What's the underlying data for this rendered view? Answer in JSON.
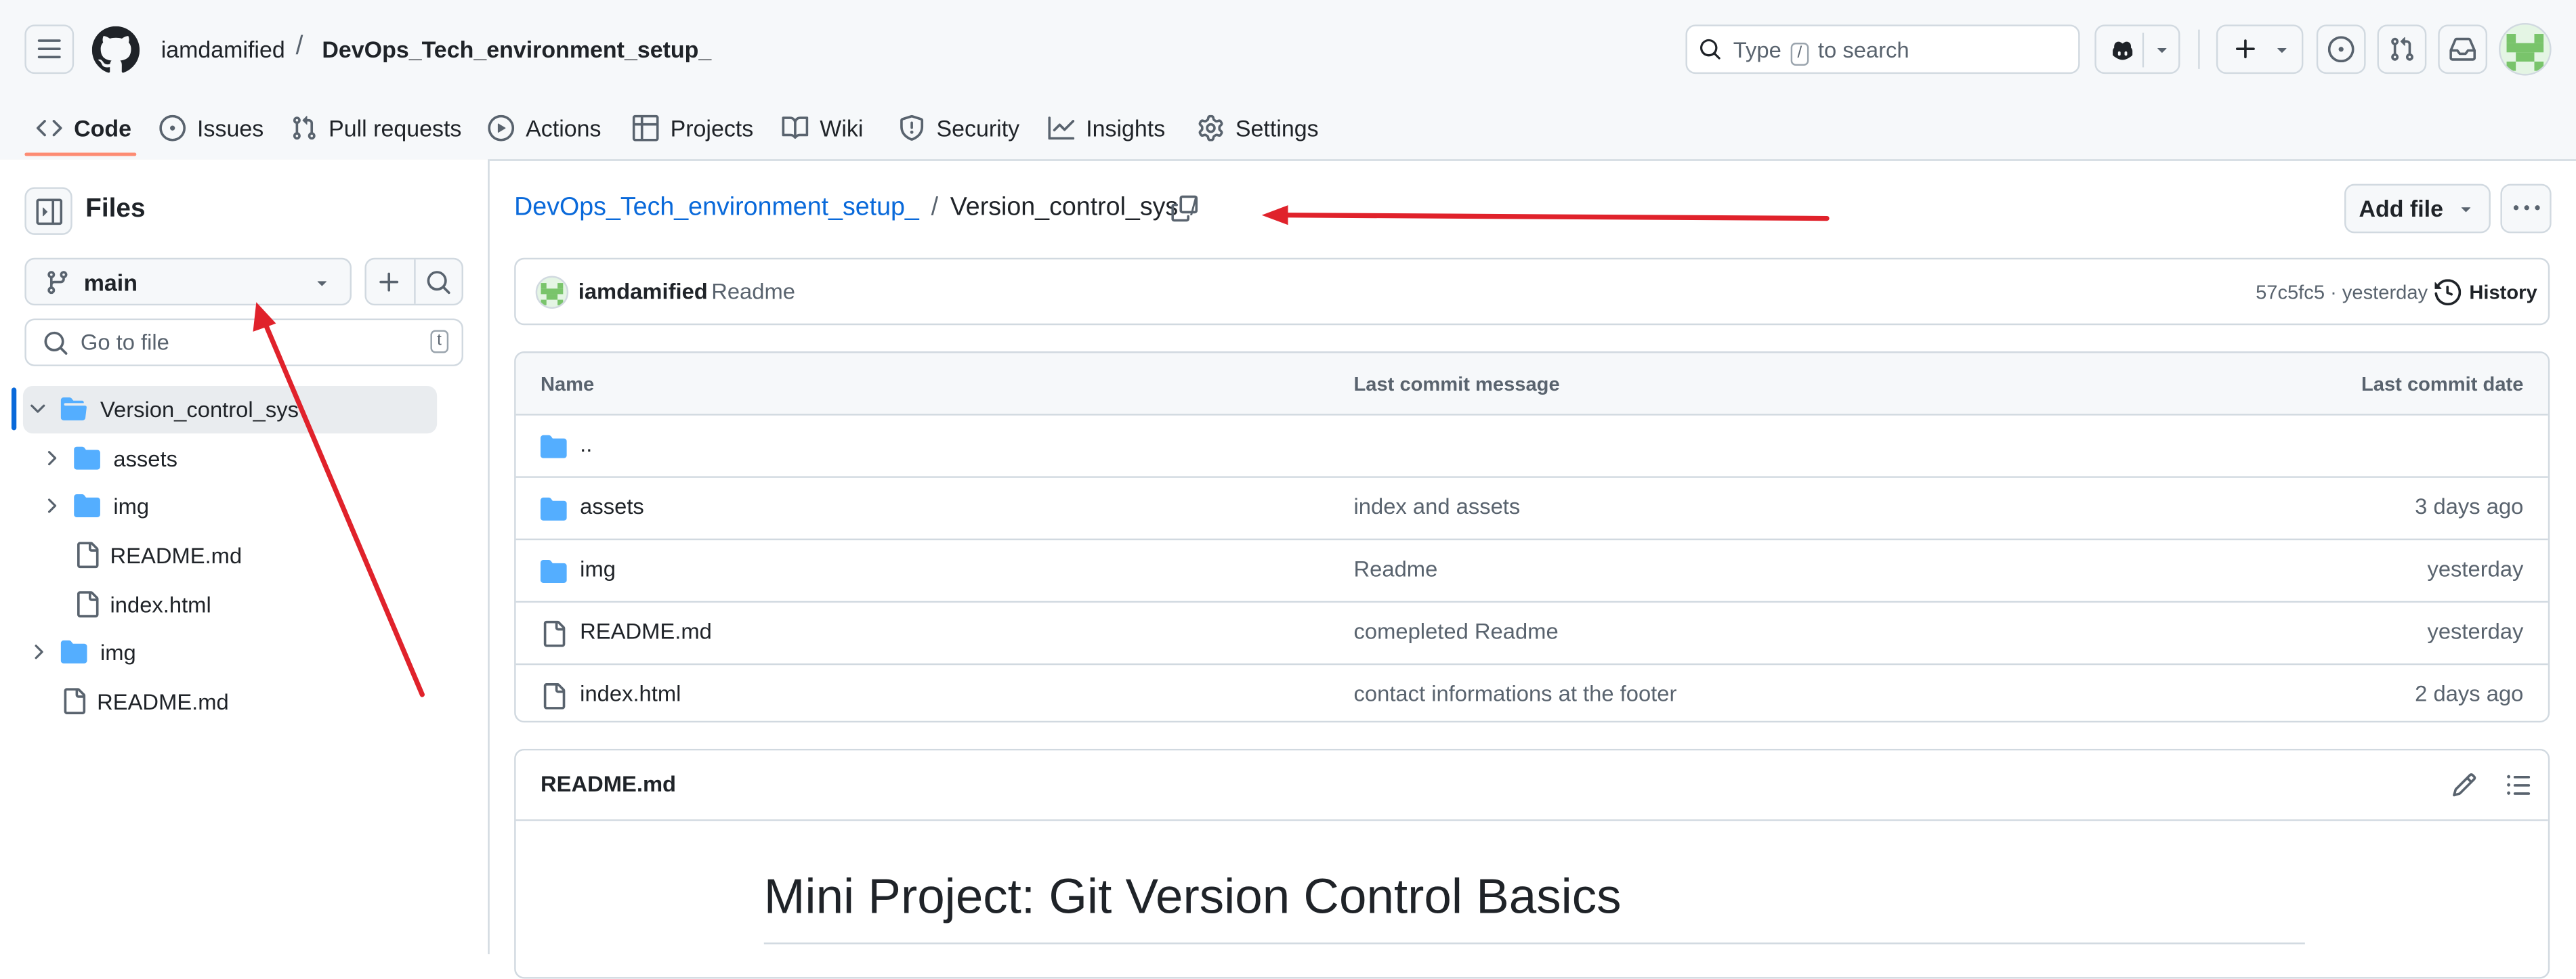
{
  "header": {
    "owner": "iamdamified",
    "separator": "/",
    "repo": "DevOps_Tech_environment_setup_",
    "search_pre": "Type",
    "search_key": "/",
    "search_post": "to search"
  },
  "tabs": [
    {
      "label": "Code",
      "icon": "code-icon"
    },
    {
      "label": "Issues",
      "icon": "issue-icon"
    },
    {
      "label": "Pull requests",
      "icon": "pull-request-icon"
    },
    {
      "label": "Actions",
      "icon": "play-icon"
    },
    {
      "label": "Projects",
      "icon": "table-icon"
    },
    {
      "label": "Wiki",
      "icon": "book-icon"
    },
    {
      "label": "Security",
      "icon": "shield-icon"
    },
    {
      "label": "Insights",
      "icon": "graph-icon"
    },
    {
      "label": "Settings",
      "icon": "gear-icon"
    }
  ],
  "sidebar": {
    "title": "Files",
    "branch": "main",
    "goto_placeholder": "Go to file",
    "goto_key": "t",
    "tree": [
      {
        "label": "Version_control_sys",
        "type": "folder-open",
        "selected": true
      },
      {
        "label": "assets",
        "type": "folder"
      },
      {
        "label": "img",
        "type": "folder"
      },
      {
        "label": "README.md",
        "type": "file"
      },
      {
        "label": "index.html",
        "type": "file"
      },
      {
        "label": "img",
        "type": "folder"
      },
      {
        "label": "README.md",
        "type": "file"
      }
    ]
  },
  "breadcrumb": {
    "repo_link": "DevOps_Tech_environment_setup_",
    "sep1": "/",
    "folder": "Version_control_sys",
    "sep2": "/"
  },
  "actions": {
    "add_file": "Add file"
  },
  "commit": {
    "author": "iamdamified",
    "message": "Readme",
    "sha_time": "57c5fc5 · yesterday",
    "history": "History"
  },
  "table": {
    "headers": [
      "Name",
      "Last commit message",
      "Last commit date"
    ],
    "rows": [
      {
        "name": "..",
        "type": "folder",
        "message": "",
        "date": ""
      },
      {
        "name": "assets",
        "type": "folder",
        "message": "index and assets",
        "date": "3 days ago"
      },
      {
        "name": "img",
        "type": "folder",
        "message": "Readme",
        "date": "yesterday"
      },
      {
        "name": "README.md",
        "type": "file",
        "message": "comepleted Readme",
        "date": "yesterday"
      },
      {
        "name": "index.html",
        "type": "file",
        "message": "contact informations at the footer",
        "date": "2 days ago"
      }
    ]
  },
  "readme": {
    "filename": "README.md",
    "heading": "Mini Project: Git Version Control Basics"
  },
  "colors": {
    "accent_link": "#0969da",
    "folder": "#54aeff",
    "annotation_arrow": "#e0222b",
    "tab_underline": "#fd8c73"
  }
}
